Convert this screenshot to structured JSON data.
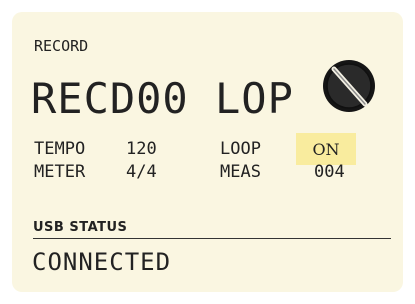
{
  "display": {
    "mode_label": "RECORD",
    "song_name": "RECD00 LOP",
    "params": {
      "tempo_label": "TEMPO",
      "tempo_value": "120",
      "loop_label": "LOOP",
      "loop_value": "ON",
      "meter_label": "METER",
      "meter_value": "4/4",
      "meas_label": "MEAS",
      "meas_value": "004"
    },
    "knob_icon": "rotary-knob-icon",
    "usb": {
      "title": "USB STATUS",
      "value": "CONNECTED"
    }
  },
  "colors": {
    "screen_background": "#faf6e1",
    "text": "#222222",
    "loop_highlight": "#f9ec9e"
  }
}
